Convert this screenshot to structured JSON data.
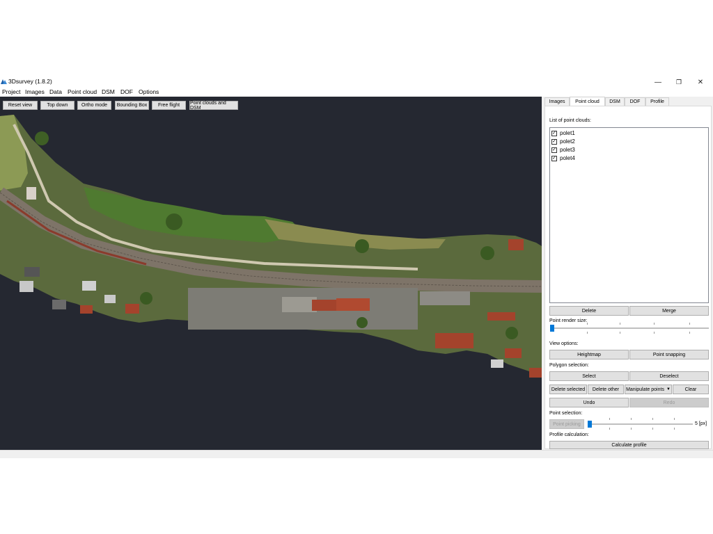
{
  "window": {
    "title": "3Dsurvey (1.8.2)",
    "minimize": "—",
    "restore": "❐",
    "close": "✕"
  },
  "menu": [
    "Project",
    "Images",
    "Data",
    "Point cloud",
    "DSM",
    "DOF",
    "Options"
  ],
  "viewport_buttons": [
    "Reset view",
    "Top down",
    "Ortho mode",
    "Bounding Box",
    "Free flight",
    "Point clouds and DSM"
  ],
  "tabs": [
    "Images",
    "Point cloud",
    "DSM",
    "DOF",
    "Profile"
  ],
  "active_tab": "Point cloud",
  "point_cloud_panel": {
    "list_label": "List of point clouds:",
    "clouds": [
      {
        "name": "polet1",
        "checked": true
      },
      {
        "name": "polet2",
        "checked": true
      },
      {
        "name": "polet3",
        "checked": true
      },
      {
        "name": "polet4",
        "checked": true
      }
    ],
    "delete_button": "Delete",
    "merge_button": "Merge",
    "render_size_label": "Point render size:",
    "render_size_value": 0,
    "view_options_label": "View options:",
    "heightmap_button": "Heightmap",
    "point_snapping_button": "Point snapping",
    "polygon_selection_label": "Polygon selection:",
    "select_button": "Select",
    "deselect_button": "Deselect",
    "delete_selected_button": "Delete selected",
    "delete_other_button": "Delete other",
    "manipulate_points_button": "Manipulate points",
    "clear_button": "Clear",
    "undo_button": "Undo",
    "redo_button": "Redo",
    "point_selection_label": "Point selection:",
    "point_picking_button": "Point picking",
    "point_picking_value": "5 [px]",
    "profile_calc_label": "Profile calculation:",
    "calculate_profile_button": "Calculate profile"
  },
  "colors": {
    "viewport_bg": "#252831",
    "slider_accent": "#0078d7",
    "terrain_green": "#4f6e34",
    "roof_red": "#a4432c"
  }
}
